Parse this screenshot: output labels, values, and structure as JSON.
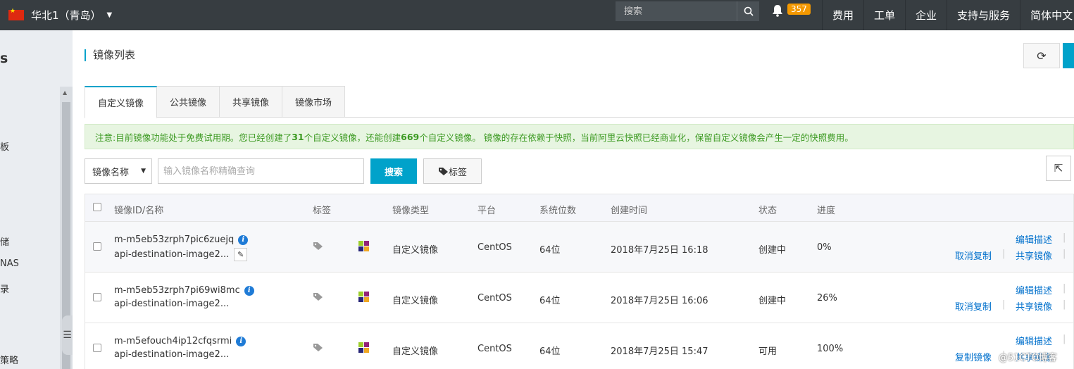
{
  "topbar": {
    "region": "华北1（青岛）",
    "search_placeholder": "搜索",
    "notifications": "357",
    "nav": [
      "费用",
      "工单",
      "企业",
      "支持与服务",
      "简体中文"
    ]
  },
  "sidebar": {
    "title": "s",
    "items": [
      "板",
      "储",
      "NAS",
      "录",
      "策略"
    ]
  },
  "page": {
    "title": "镜像列表",
    "tabs": [
      "自定义镜像",
      "公共镜像",
      "共享镜像",
      "镜像市场"
    ],
    "active_tab": 0
  },
  "notice": {
    "p1": "注意:目前镜像功能处于免费试用期。您已经创建了",
    "created": "31",
    "p2": "个自定义镜像，还能创建",
    "remaining": "669",
    "p3": "个自定义镜像。 镜像的存在依赖于快照，当前阿里云快照已经商业化，保留自定义镜像会产生一定的快照费用。"
  },
  "filter": {
    "select_value": "镜像名称",
    "input_placeholder": "输入镜像名称精确查询",
    "search_label": "搜索",
    "tag_label": "标签"
  },
  "table": {
    "columns": [
      "镜像ID/名称",
      "标签",
      "镜像类型",
      "平台",
      "系统位数",
      "创建时间",
      "状态",
      "进度"
    ],
    "rows": [
      {
        "id": "m-m5eb53zrph7pic6zuejq",
        "name": "api-destination-image2...",
        "type": "自定义镜像",
        "platform": "CentOS",
        "bits": "64位",
        "created": "2018年7月25日 16:18",
        "status": "创建中",
        "progress": "0%",
        "actions": [
          "编辑描述",
          "取消复制",
          "共享镜像"
        ]
      },
      {
        "id": "m-m5eb53zrph7pi69wi8mc",
        "name": "api-destination-image2...",
        "type": "自定义镜像",
        "platform": "CentOS",
        "bits": "64位",
        "created": "2018年7月25日 16:06",
        "status": "创建中",
        "progress": "26%",
        "actions": [
          "编辑描述",
          "取消复制",
          "共享镜像"
        ]
      },
      {
        "id": "m-m5efouch4ip12cfqsrmi",
        "name": "api-destination-image2...",
        "type": "自定义镜像",
        "platform": "CentOS",
        "bits": "64位",
        "created": "2018年7月25日 15:47",
        "status": "可用",
        "progress": "100%",
        "actions": [
          "编辑描述",
          "复制镜像",
          "共享镜像"
        ]
      }
    ]
  },
  "watermark": "@51CTO博客"
}
